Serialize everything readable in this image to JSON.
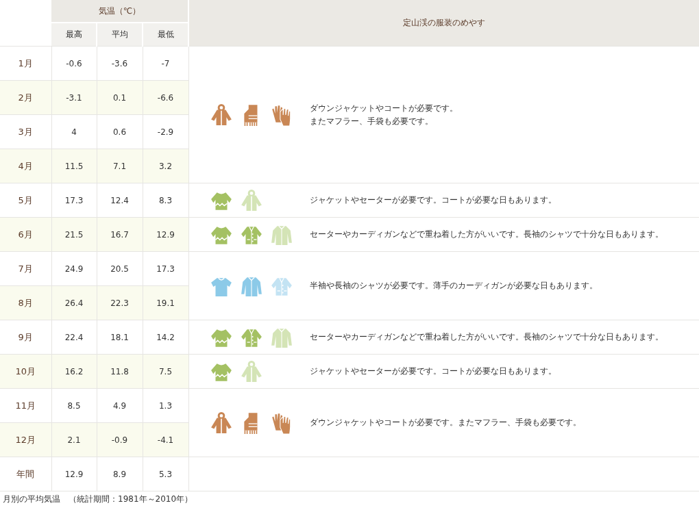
{
  "header": {
    "temperature": "気温（℃）",
    "columns": [
      "最高",
      "平均",
      "最低"
    ],
    "guide": "定山渓の服装のめやす"
  },
  "groups": [
    {
      "months": [
        {
          "month": "1月",
          "high": "-0.6",
          "avg": "-3.6",
          "low": "-7"
        },
        {
          "month": "2月",
          "high": "-3.1",
          "avg": "0.1",
          "low": "-6.6"
        },
        {
          "month": "3月",
          "high": "4",
          "avg": "0.6",
          "low": "-2.9"
        },
        {
          "month": "4月",
          "high": "11.5",
          "avg": "7.1",
          "low": "3.2"
        }
      ],
      "icons": [
        {
          "kind": "hooded-jacket",
          "color": "#c98755"
        },
        {
          "kind": "scarf",
          "color": "#c98755"
        },
        {
          "kind": "gloves",
          "color": "#c98755"
        }
      ],
      "lines": [
        "ダウンジャケットやコートが必要です。",
        "またマフラー、手袋も必要です。"
      ]
    },
    {
      "months": [
        {
          "month": "5月",
          "high": "17.3",
          "avg": "12.4",
          "low": "8.3"
        }
      ],
      "icons": [
        {
          "kind": "sweater",
          "color": "#a4c163"
        },
        {
          "kind": "hooded-jacket",
          "color": "#d4e4b6"
        }
      ],
      "lines": [
        "ジャケットやセーターが必要です。コートが必要な日もあります。"
      ]
    },
    {
      "months": [
        {
          "month": "6月",
          "high": "21.5",
          "avg": "16.7",
          "low": "12.9"
        }
      ],
      "icons": [
        {
          "kind": "sweater",
          "color": "#a4c163"
        },
        {
          "kind": "cardigan",
          "color": "#a4c163"
        },
        {
          "kind": "long-shirt",
          "color": "#d4e4b6"
        }
      ],
      "lines": [
        "セーターやカーディガンなどで重ね着した方がいいです。長袖のシャツで十分な日もあります。"
      ]
    },
    {
      "months": [
        {
          "month": "7月",
          "high": "24.9",
          "avg": "20.5",
          "low": "17.3"
        },
        {
          "month": "8月",
          "high": "26.4",
          "avg": "22.3",
          "low": "19.1"
        }
      ],
      "icons": [
        {
          "kind": "tshirt",
          "color": "#8ccae8"
        },
        {
          "kind": "long-shirt",
          "color": "#8ccae8"
        },
        {
          "kind": "cardigan",
          "color": "#c3e3f3"
        }
      ],
      "lines": [
        "半袖や長袖のシャツが必要です。薄手のカーディガンが必要な日もあります。"
      ]
    },
    {
      "months": [
        {
          "month": "9月",
          "high": "22.4",
          "avg": "18.1",
          "low": "14.2"
        }
      ],
      "icons": [
        {
          "kind": "sweater",
          "color": "#a4c163"
        },
        {
          "kind": "cardigan",
          "color": "#a4c163"
        },
        {
          "kind": "long-shirt",
          "color": "#d4e4b6"
        }
      ],
      "lines": [
        "セーターやカーディガンなどで重ね着した方がいいです。長袖のシャツで十分な日もあります。"
      ]
    },
    {
      "months": [
        {
          "month": "10月",
          "high": "16.2",
          "avg": "11.8",
          "low": "7.5"
        }
      ],
      "icons": [
        {
          "kind": "sweater",
          "color": "#a4c163"
        },
        {
          "kind": "hooded-jacket",
          "color": "#d4e4b6"
        }
      ],
      "lines": [
        "ジャケットやセーターが必要です。コートが必要な日もあります。"
      ]
    },
    {
      "months": [
        {
          "month": "11月",
          "high": "8.5",
          "avg": "4.9",
          "low": "1.3"
        },
        {
          "month": "12月",
          "high": "2.1",
          "avg": "-0.9",
          "low": "-4.1"
        }
      ],
      "icons": [
        {
          "kind": "hooded-jacket",
          "color": "#c98755"
        },
        {
          "kind": "scarf",
          "color": "#c98755"
        },
        {
          "kind": "gloves",
          "color": "#c98755"
        }
      ],
      "lines": [
        "ダウンジャケットやコートが必要です。またマフラー、手袋も必要です。"
      ]
    },
    {
      "months": [
        {
          "month": "年間",
          "high": "12.9",
          "avg": "8.9",
          "low": "5.3"
        }
      ]
    }
  ],
  "caption": "月別の平均気温　（統計期間：1981年～2010年）"
}
